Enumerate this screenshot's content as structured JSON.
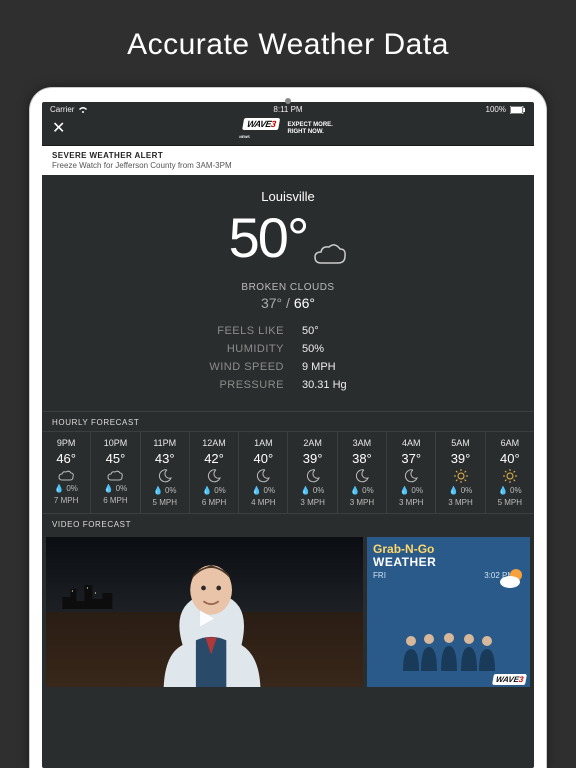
{
  "hero": {
    "title": "Accurate Weather Data"
  },
  "status": {
    "carrier": "Carrier",
    "time": "8:11 PM",
    "battery": "100%"
  },
  "brand": {
    "logo_main": "WAVE",
    "logo_num": "3",
    "logo_sub": "NEWS",
    "tagline_1": "EXPECT MORE.",
    "tagline_2": "RIGHT NOW."
  },
  "alert": {
    "title": "SEVERE WEATHER ALERT",
    "msg": "Freeze Watch for Jefferson County from 3AM-3PM"
  },
  "current": {
    "city": "Louisville",
    "temp": "50°",
    "condition": "BROKEN CLOUDS",
    "lo": "37°",
    "hi": "66°",
    "feels_label": "FEELS LIKE",
    "feels": "50°",
    "humidity_label": "HUMIDITY",
    "humidity": "50%",
    "wind_label": "WIND SPEED",
    "wind": "9 MPH",
    "pressure_label": "PRESSURE",
    "pressure": "30.31 Hg"
  },
  "hourly_header": "HOURLY FORECAST",
  "hourly": [
    {
      "time": "9PM",
      "temp": "46°",
      "icon": "cloud",
      "precip": "0%",
      "wind": "7 MPH"
    },
    {
      "time": "10PM",
      "temp": "45°",
      "icon": "cloud",
      "precip": "0%",
      "wind": "6 MPH"
    },
    {
      "time": "11PM",
      "temp": "43°",
      "icon": "moon",
      "precip": "0%",
      "wind": "5 MPH"
    },
    {
      "time": "12AM",
      "temp": "42°",
      "icon": "moon",
      "precip": "0%",
      "wind": "6 MPH"
    },
    {
      "time": "1AM",
      "temp": "40°",
      "icon": "moon",
      "precip": "0%",
      "wind": "4 MPH"
    },
    {
      "time": "2AM",
      "temp": "39°",
      "icon": "moon",
      "precip": "0%",
      "wind": "3 MPH"
    },
    {
      "time": "3AM",
      "temp": "38°",
      "icon": "moon",
      "precip": "0%",
      "wind": "3 MPH"
    },
    {
      "time": "4AM",
      "temp": "37°",
      "icon": "moon",
      "precip": "0%",
      "wind": "3 MPH"
    },
    {
      "time": "5AM",
      "temp": "39°",
      "icon": "sun",
      "precip": "0%",
      "wind": "3 MPH"
    },
    {
      "time": "6AM",
      "temp": "40°",
      "icon": "sun",
      "precip": "0%",
      "wind": "5 MPH"
    }
  ],
  "video_header": "VIDEO FORECAST",
  "side": {
    "line1": "Grab-N-Go",
    "line2": "WEATHER",
    "day": "FRI",
    "time": "3:02 PM"
  }
}
